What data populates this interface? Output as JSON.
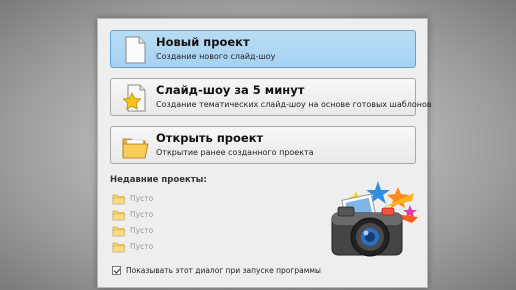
{
  "actions": [
    {
      "title": "Новый проект",
      "description": "Создание нового слайд-шоу",
      "icon": "blank-page-icon",
      "selected": true
    },
    {
      "title": "Слайд-шоу за 5 минут",
      "description": "Создание тематических слайд-шоу на основе готовых шаблонов",
      "icon": "star-page-icon",
      "selected": false
    },
    {
      "title": "Открыть проект",
      "description": "Открытие ранее созданного проекта",
      "icon": "open-folder-icon",
      "selected": false
    }
  ],
  "recent": {
    "heading": "Недавние проекты:",
    "items": [
      "Пусто",
      "Пусто",
      "Пусто",
      "Пусто"
    ]
  },
  "startup_checkbox": {
    "label": "Показывать этот диалог при запуске программы",
    "checked": true
  },
  "colors": {
    "selected_bg": "#a9d4f3",
    "selected_border": "#6aa0c8",
    "disabled_text": "#9a9a9a"
  }
}
